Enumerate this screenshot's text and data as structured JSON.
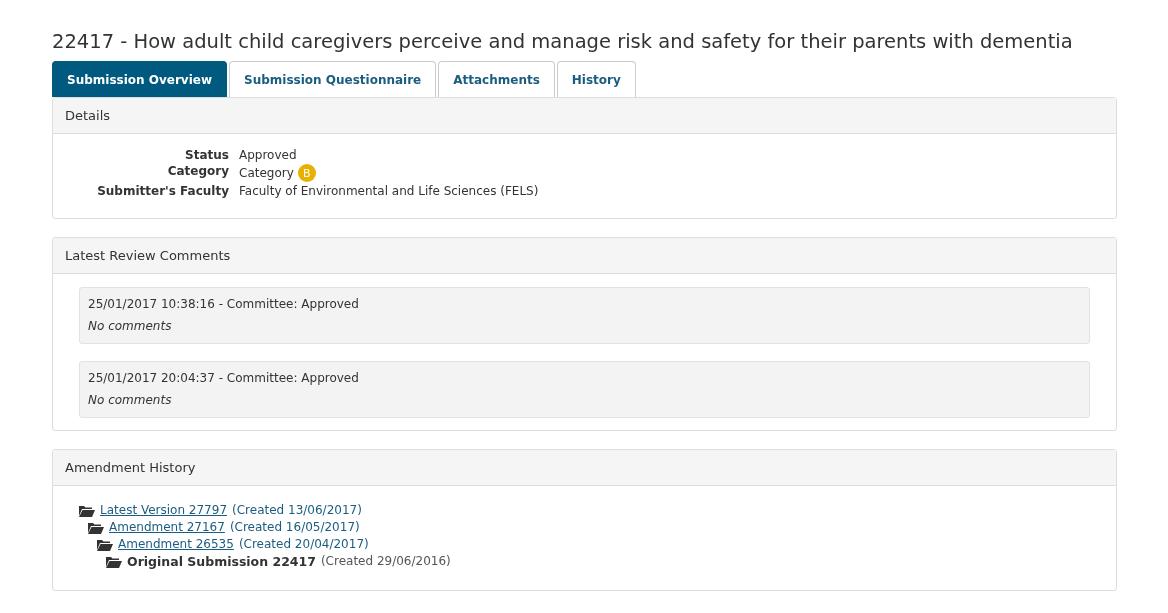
{
  "title": "22417 - How adult child caregivers perceive and manage risk and safety for their parents with dementia",
  "tabs": [
    {
      "label": "Submission Overview",
      "selected": true
    },
    {
      "label": "Submission Questionnaire",
      "selected": false
    },
    {
      "label": "Attachments",
      "selected": false
    },
    {
      "label": "History",
      "selected": false
    }
  ],
  "details": {
    "heading": "Details",
    "fields": [
      {
        "label": "Status",
        "value": "Approved"
      },
      {
        "label": "Category",
        "value": "Category",
        "badge": "B"
      },
      {
        "label": "Submitter's Faculty",
        "value": "Faculty of Environmental and Life Sciences (FELS)"
      }
    ]
  },
  "review_comments": {
    "heading": "Latest Review Comments",
    "items": [
      {
        "header": "25/01/2017 10:38:16 - Committee: Approved",
        "comment": "No comments"
      },
      {
        "header": "25/01/2017 20:04:37 - Committee: Approved",
        "comment": "No comments"
      }
    ]
  },
  "amendment_history": {
    "heading": "Amendment History",
    "tree": [
      {
        "kind": "link",
        "label": "Latest Version 27797",
        "created": "(Created 13/06/2017)",
        "children": [
          {
            "kind": "link",
            "label": "Amendment 27167",
            "created": "(Created 16/05/2017)",
            "children": [
              {
                "kind": "link",
                "label": "Amendment 26535",
                "created": "(Created 20/04/2017)",
                "children": [
                  {
                    "kind": "current",
                    "label": "Original Submission 22417",
                    "created": "(Created 29/06/2016)"
                  }
                ]
              }
            ]
          }
        ]
      }
    ]
  }
}
